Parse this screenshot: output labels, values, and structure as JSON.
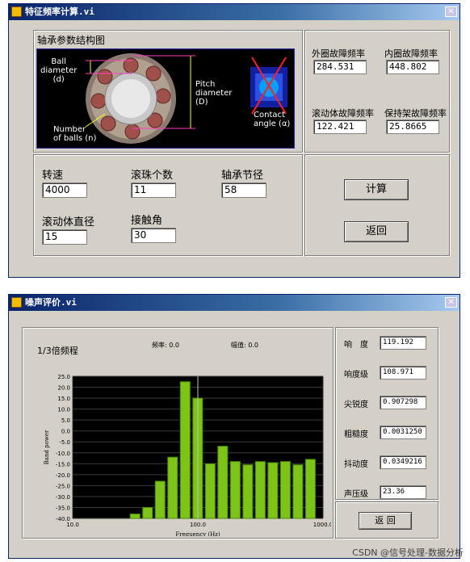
{
  "win1": {
    "title": "特征频率计算.vi",
    "close_glyph": "✕",
    "diagram_title": "轴承参数结构图",
    "diagram_labels": {
      "ball_diameter": [
        "Ball",
        "diameter",
        "(d)"
      ],
      "pitch_diameter": [
        "Pitch",
        "diameter",
        "(D)"
      ],
      "number_of_balls": [
        "Number",
        "of balls (n)"
      ],
      "contact_angle": [
        "Contact",
        "angle (α)"
      ]
    },
    "outputs": [
      {
        "label": "外圈故障频率",
        "value": "284.531"
      },
      {
        "label": "内圈故障频率",
        "value": "448.802"
      },
      {
        "label": "滚动体故障频率",
        "value": "122.421"
      },
      {
        "label": "保持架故障频率",
        "value": "25.8665"
      }
    ],
    "inputs": [
      {
        "label": "转速",
        "value": "4000"
      },
      {
        "label": "滚珠个数",
        "value": "11"
      },
      {
        "label": "轴承节径",
        "value": "58"
      },
      {
        "label": "滚动体直径",
        "value": "15"
      },
      {
        "label": "接触角",
        "value": "30"
      }
    ],
    "calc_label": "计算",
    "back_label": "返回"
  },
  "win2": {
    "title": "噪声评价.vi",
    "close_glyph": "✕",
    "chart_title": "1/3倍频程",
    "freq_readout": "频率: 0.0",
    "amp_readout": "幅值: 0.0",
    "metrics": [
      {
        "label": "响　度",
        "value": "119.192"
      },
      {
        "label": "响度级",
        "value": "108.971"
      },
      {
        "label": "尖锐度",
        "value": "0.907298"
      },
      {
        "label": "粗糙度",
        "value": "0.0031250"
      },
      {
        "label": "抖动度",
        "value": "0.0349216"
      },
      {
        "label": "声压级",
        "value": "23.36"
      }
    ],
    "back_label": "返  回"
  },
  "watermark": "CSDN @信号处理-数据分析",
  "chart_data": {
    "type": "bar",
    "title": "1/3倍频程",
    "xlabel": "Frequency (Hz)",
    "ylabel": "Band power",
    "xscale": "log",
    "xlim": [
      10,
      1000
    ],
    "ylim": [
      -40,
      25
    ],
    "xticks": [
      "10.0",
      "100.0",
      "1000.0"
    ],
    "yticks": [
      "25.0",
      "20.0",
      "15.0",
      "10.0",
      "5.0",
      "0.0",
      "-5.0",
      "-10.0",
      "-15.0",
      "-20.0",
      "-25.0",
      "-30.0",
      "-35.0",
      "-40.0"
    ],
    "grid": true,
    "bar_color": "#7cc418",
    "cursor_x": 100,
    "x": [
      31.5,
      40,
      50,
      63,
      80,
      100,
      125,
      160,
      200,
      250,
      315,
      400,
      500,
      630
    ],
    "values": [
      -38,
      -35,
      -23,
      -12,
      22.5,
      15,
      -15,
      -7,
      -14,
      -15.5,
      -14,
      -14.5,
      -14,
      -15.5,
      -13
    ]
  }
}
